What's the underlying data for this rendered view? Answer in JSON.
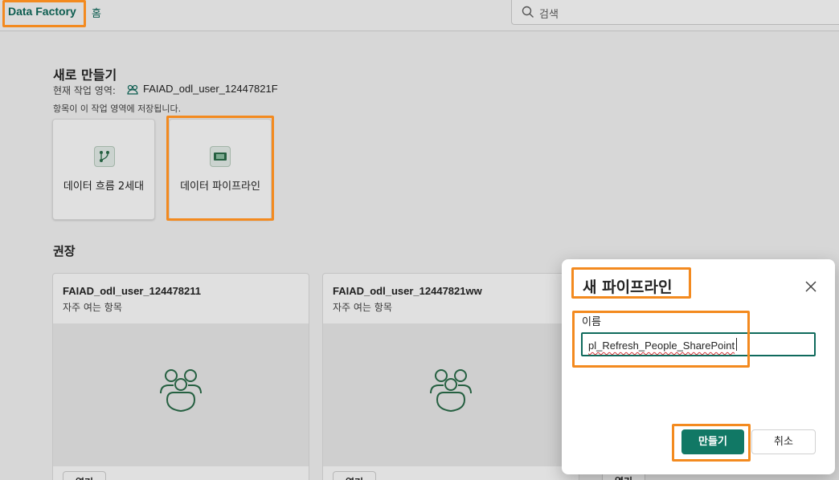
{
  "header": {
    "brand": "Data Factory",
    "home": "홈",
    "search_placeholder": "검색"
  },
  "create_new": {
    "title": "새로 만들기",
    "workspace_label": "현재 작업 영역:",
    "workspace_name": "FAIAD_odl_user_12447821F",
    "saved_note": "항목이 이 작업 영역에 저장됩니다.",
    "tiles": [
      {
        "label": "데이터 흐름 2세대",
        "icon": "dataflow-icon"
      },
      {
        "label": "데이터 파이프라인",
        "icon": "pipeline-icon"
      }
    ]
  },
  "recommended": {
    "title": "권장",
    "cards": [
      {
        "title": "FAIAD_odl_user_124478211",
        "subtitle": "자주 여는 항목",
        "open_label": "열기",
        "icon": "people-icon"
      },
      {
        "title": "FAIAD_odl_user_12447821ww",
        "subtitle": "자주 여는 항목",
        "open_label": "열기",
        "icon": "people-icon"
      }
    ],
    "third_open_label": "열기"
  },
  "dialog": {
    "title": "새 파이프라인",
    "name_label": "이름",
    "name_value": "pl_Refresh_People_SharePoint",
    "create_label": "만들기",
    "cancel_label": "취소"
  },
  "colors": {
    "brand": "#0f6a5c",
    "primary_button": "#117865",
    "highlight": "#f38a1f"
  }
}
